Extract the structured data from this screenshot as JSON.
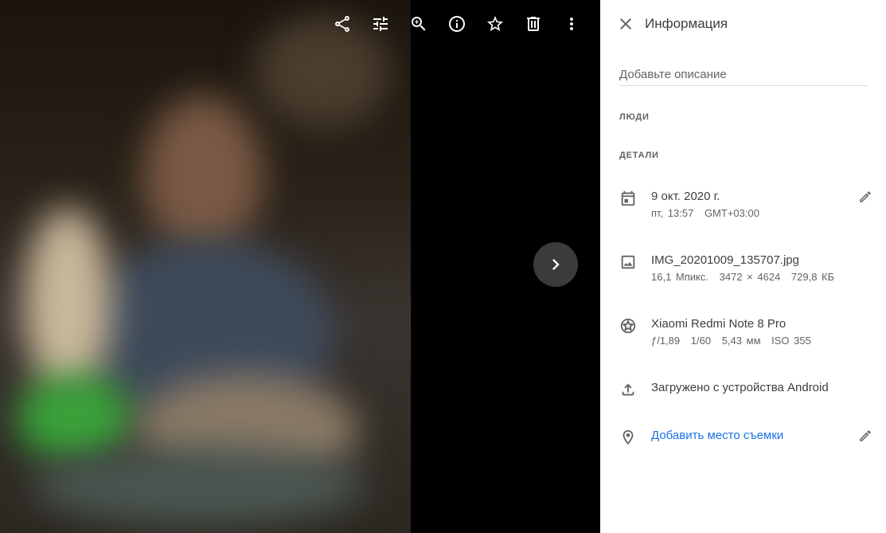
{
  "viewer": {
    "toolbar": [
      {
        "name": "share-icon"
      },
      {
        "name": "edit-tune-icon"
      },
      {
        "name": "zoom-in-icon"
      },
      {
        "name": "info-icon"
      },
      {
        "name": "star-icon"
      },
      {
        "name": "trash-icon"
      },
      {
        "name": "more-vert-icon"
      }
    ],
    "next_icon": "chevron-right-icon"
  },
  "panel": {
    "title": "Информация",
    "description_placeholder": "Добавьте описание",
    "people_label": "ЛЮДИ",
    "details_label": "ДЕТАЛИ",
    "date": {
      "primary": "9 окт. 2020 г.",
      "day_time": "пт, 13:57",
      "timezone": "GMT+03:00"
    },
    "file": {
      "name": "IMG_20201009_135707.jpg",
      "megapixels": "16,1 Мпикс.",
      "resolution": "3472 × 4624",
      "size": "729,8 КБ"
    },
    "camera": {
      "model": "Xiaomi Redmi Note 8 Pro",
      "aperture": "ƒ/1,89",
      "shutter": "1/60",
      "focal": "5,43 мм",
      "iso": "ISO 355"
    },
    "upload": "Загружено с устройства Android",
    "location_link": "Добавить место съемки"
  },
  "colors": {
    "link": "#1a73e8",
    "text": "#3c4043",
    "secondary": "#5f6368"
  }
}
